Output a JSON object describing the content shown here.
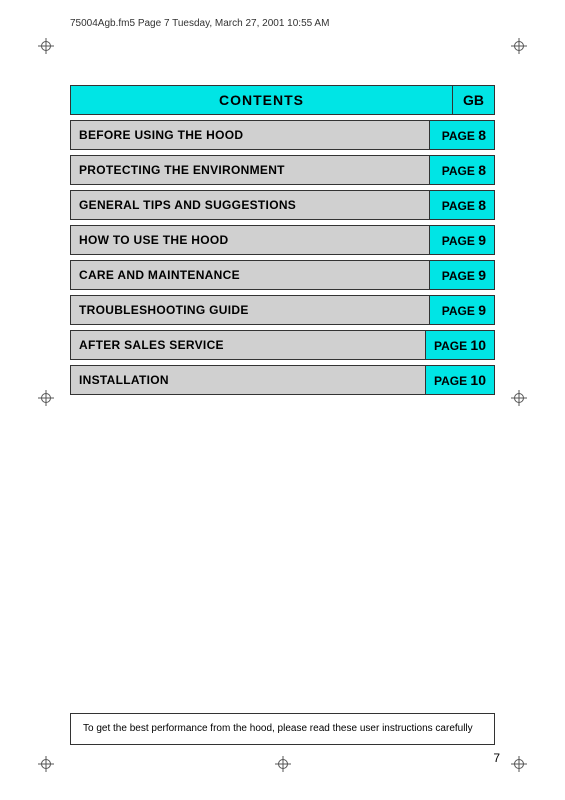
{
  "header": {
    "text": "75004Agb.fm5  Page 7  Tuesday, March 27, 2001  10:55 AM"
  },
  "contents": {
    "title": "CONTENTS",
    "gb_label": "GB"
  },
  "toc_items": [
    {
      "label": "BEFORE USING THE HOOD",
      "page_word": "PAGE",
      "page_num": "8"
    },
    {
      "label": "PROTECTING THE ENVIRONMENT",
      "page_word": "PAGE",
      "page_num": "8"
    },
    {
      "label": "GENERAL TIPS AND SUGGESTIONS",
      "page_word": "PAGE",
      "page_num": "8"
    },
    {
      "label": "HOW TO USE THE HOOD",
      "page_word": "PAGE",
      "page_num": "9"
    },
    {
      "label": "CARE AND MAINTENANCE",
      "page_word": "PAGE",
      "page_num": "9"
    },
    {
      "label": "TROUBLESHOOTING GUIDE",
      "page_word": "PAGE",
      "page_num": "9"
    },
    {
      "label": "AFTER SALES SERVICE",
      "page_word": "PAGE",
      "page_num": "10"
    },
    {
      "label": "INSTALLATION",
      "page_word": "PAGE",
      "page_num": "10"
    }
  ],
  "bottom_note": {
    "text": "To get the best performance from the hood, please read these user instructions carefully"
  },
  "page_number": "7"
}
